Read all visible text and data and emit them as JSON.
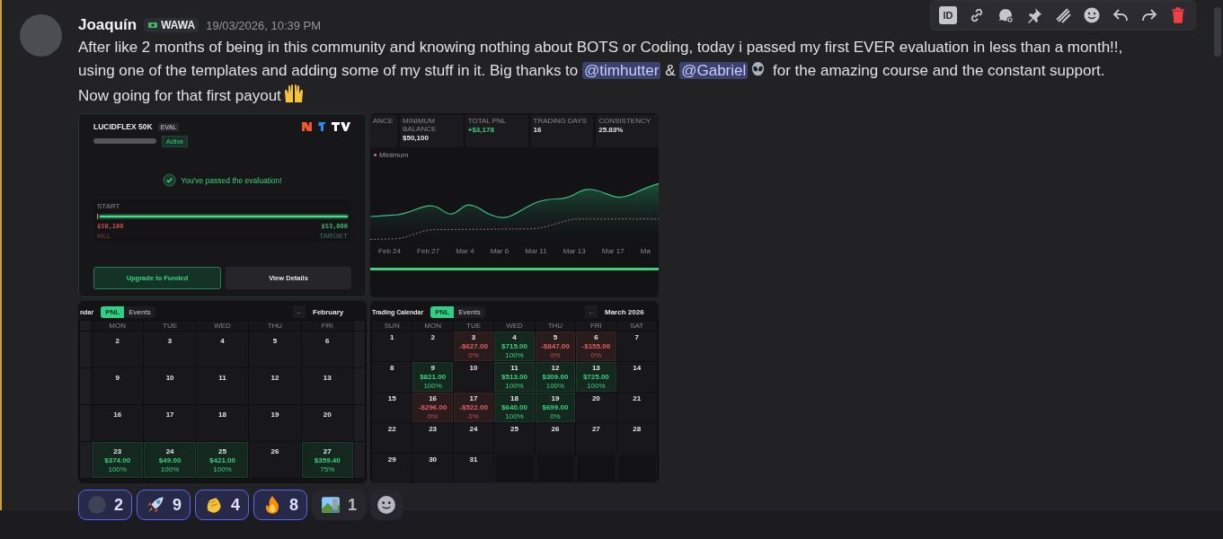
{
  "toolbar": {
    "id_badge": "ID"
  },
  "message": {
    "author": "Joaquín",
    "tag": "WAWA",
    "timestamp": "19/03/2026, 10:39 PM",
    "highlighted": true,
    "content": [
      {
        "kind": "text",
        "text": "After like 2 months of being in this community and knowing nothing about BOTS or Coding, today i passed my first EVER evaluation in less than a month!!, using one of the templates and adding some of my stuff in it. Big thanks to "
      },
      {
        "kind": "mention",
        "text": "@timhutter"
      },
      {
        "kind": "text",
        "text": " & "
      },
      {
        "kind": "mention",
        "text": "@Gabriel"
      },
      {
        "kind": "alien"
      },
      {
        "kind": "text",
        "text": " for the amazing course and the constant support. Now going for that first payout"
      },
      {
        "kind": "hands"
      }
    ]
  },
  "account_card": {
    "title": "LUCIDFLEX 50K",
    "badge": "EVAL",
    "status": "Active",
    "passed_message": "You've passed the evaluation!",
    "start_label": "START",
    "level": 1,
    "low_value": "$50,100",
    "high_value": "$53,000",
    "low_label": "MLL",
    "high_label": "TARGET",
    "buttons": [
      {
        "label": "Upgrade to Funded",
        "kind": "primary"
      },
      {
        "label": "View Details",
        "kind": "secondary"
      }
    ]
  },
  "stats_panel": {
    "stats": [
      {
        "label": "ANCE"
      },
      {
        "label": "MINIMUM BALANCE",
        "value": "$50,100"
      },
      {
        "label": "TOTAL PNL",
        "value": "+$3,178",
        "kind": "gain"
      },
      {
        "label": "TRADING DAYS",
        "value": "16"
      },
      {
        "label": "CONSISTENCY",
        "value": "25.83%"
      }
    ],
    "legend": "Minimum",
    "x_labels": [
      "Feb 24",
      "Feb 27",
      "Mar 4",
      "Mar 6",
      "Mar 11",
      "Mar 13",
      "Mar 17",
      "Ma"
    ]
  },
  "calendars": [
    {
      "title": "ndar",
      "toggle": [
        {
          "label": "PNL",
          "selected": true
        },
        {
          "label": "Events",
          "selected": false
        }
      ],
      "nav": "←",
      "month": "February",
      "lead_blank": true,
      "trail_blank": true,
      "headers": [
        "MON",
        "TUE",
        "WED",
        "THU",
        "FRI"
      ],
      "weeks": [
        [
          {
            "day": "2"
          },
          {
            "day": "3"
          },
          {
            "day": "4"
          },
          {
            "day": "5"
          },
          {
            "day": "6"
          }
        ],
        [
          {
            "day": "9"
          },
          {
            "day": "10"
          },
          {
            "day": "11"
          },
          {
            "day": "12"
          },
          {
            "day": "13"
          }
        ],
        [
          {
            "day": "16"
          },
          {
            "day": "17"
          },
          {
            "day": "18"
          },
          {
            "day": "19"
          },
          {
            "day": "20"
          }
        ],
        [
          {
            "day": "23",
            "pnl": "$374.00",
            "pct": "100%",
            "kind": "win"
          },
          {
            "day": "24",
            "pnl": "$49.00",
            "pct": "100%",
            "kind": "win"
          },
          {
            "day": "25",
            "pnl": "$421.00",
            "pct": "100%",
            "kind": "win"
          },
          {
            "day": "26"
          },
          {
            "day": "27",
            "pnl": "$359.40",
            "pct": "75%",
            "kind": "win"
          }
        ]
      ]
    },
    {
      "title": "Trading Calendar",
      "toggle": [
        {
          "label": "PNL",
          "selected": true
        },
        {
          "label": "Events",
          "selected": false
        }
      ],
      "nav": "←",
      "month": "March 2026",
      "lead_blank": false,
      "trail_blank": false,
      "headers": [
        "SUN",
        "MON",
        "TUE",
        "WED",
        "THU",
        "FRI",
        "SAT"
      ],
      "weeks": [
        [
          {
            "day": "1"
          },
          {
            "day": "2"
          },
          {
            "day": "3",
            "pnl": "-$627.00",
            "pct": "0%",
            "kind": "loss"
          },
          {
            "day": "4",
            "pnl": "$715.00",
            "pct": "100%",
            "kind": "win"
          },
          {
            "day": "5",
            "pnl": "-$847.00",
            "pct": "0%",
            "kind": "loss"
          },
          {
            "day": "6",
            "pnl": "-$155.00",
            "pct": "0%",
            "kind": "loss"
          },
          {
            "day": "7"
          }
        ],
        [
          {
            "day": "8"
          },
          {
            "day": "9",
            "pnl": "$821.00",
            "pct": "100%",
            "kind": "win"
          },
          {
            "day": "10"
          },
          {
            "day": "11",
            "pnl": "$513.00",
            "pct": "100%",
            "kind": "win"
          },
          {
            "day": "12",
            "pnl": "$309.00",
            "pct": "100%",
            "kind": "win"
          },
          {
            "day": "13",
            "pnl": "$725.00",
            "pct": "100%",
            "kind": "win"
          },
          {
            "day": "14"
          }
        ],
        [
          {
            "day": "15"
          },
          {
            "day": "16",
            "pnl": "-$296.00",
            "pct": "0%",
            "kind": "loss"
          },
          {
            "day": "17",
            "pnl": "-$522.00",
            "pct": "0%",
            "kind": "loss"
          },
          {
            "day": "18",
            "pnl": "$640.00",
            "pct": "100%",
            "kind": "win"
          },
          {
            "day": "19",
            "pnl": "$699.00",
            "pct": "0%",
            "kind": "win"
          },
          {
            "day": "20"
          },
          {
            "day": "21"
          }
        ],
        [
          {
            "day": "22"
          },
          {
            "day": "23"
          },
          {
            "day": "24"
          },
          {
            "day": "25"
          },
          {
            "day": "26"
          },
          {
            "day": "27"
          },
          {
            "day": "28"
          }
        ],
        [
          {
            "day": "29"
          },
          {
            "day": "30"
          },
          {
            "day": "31"
          },
          {
            "kind": "empty"
          },
          {
            "kind": "empty"
          },
          {
            "kind": "empty"
          },
          {
            "kind": "empty"
          }
        ]
      ]
    }
  ],
  "reactions": [
    {
      "kind": "blank",
      "count": "2",
      "selected": true
    },
    {
      "kind": "rocket",
      "count": "9",
      "selected": true
    },
    {
      "kind": "clap",
      "count": "4",
      "selected": true
    },
    {
      "kind": "fire",
      "count": "8",
      "selected": true
    },
    {
      "kind": "landscape",
      "count": "1",
      "selected": false
    }
  ]
}
